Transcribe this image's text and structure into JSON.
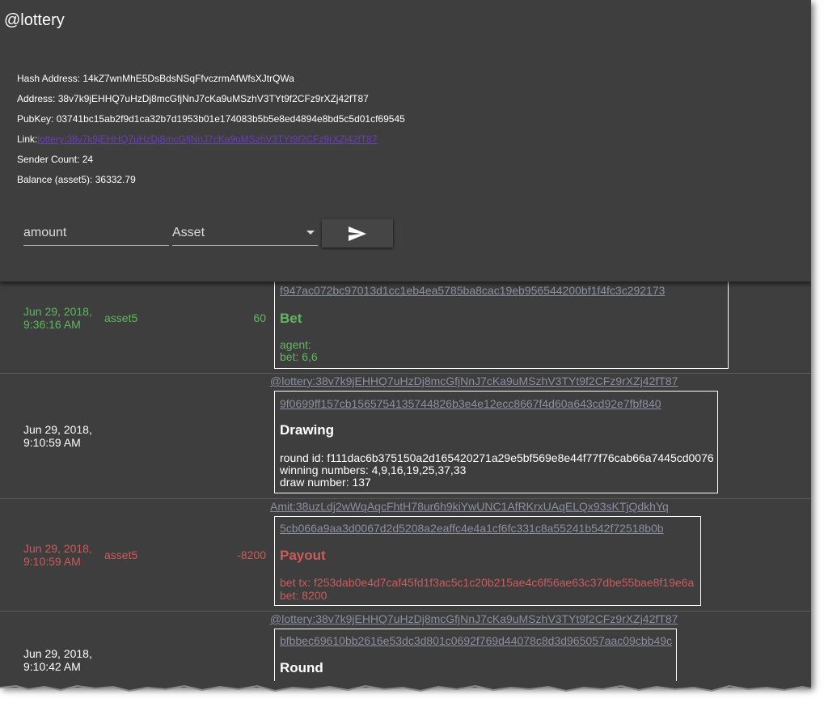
{
  "header": {
    "title": "@lottery",
    "hash_address": "Hash Address: 14kZ7wnMhE5DsBdsNSqFfvczrmAfWfsXJtrQWa",
    "address": "Address: 38v7k9jEHHQ7uHzDj8mcGfjNnJ7cKa9uMSzhV3TYt9f2CFz9rXZj42fT87",
    "pubkey": "PubKey: 03741bc15ab2f9d1ca32b7d1953b01e174083b5b5e8ed4894e8bd5c5d01cf69545",
    "link_label": "Link:",
    "link_text": "lottery:38v7k9jEHHQ7uHzDj8mcGfjNnJ7cKa9uMSzhV3TYt9f2CFz9rXZj42fT87",
    "sender_count": "Sender Count: 24",
    "balance": "Balance (asset5): 36332.79"
  },
  "form": {
    "amount_placeholder": "amount",
    "asset_placeholder": "Asset",
    "send_icon": "send-icon"
  },
  "colors": {
    "background": "#3e3e3e",
    "credit": "#5fb760",
    "debit": "#cc5b5b",
    "link": "#8a8fa0"
  },
  "transactions": [
    {
      "date_line1": "Jun 29, 2018,",
      "date_line2": "9:36:16 AM",
      "asset": "asset5",
      "amount": "60",
      "sender": "",
      "txid": "f947ac072bc97013d1cc1eb4ea5785ba8cac19eb956544200bf1f4fc3c292173",
      "type": "Bet",
      "details": [
        "agent:",
        "bet: 6,6"
      ]
    },
    {
      "date_line1": "Jun 29, 2018,",
      "date_line2": "9:10:59 AM",
      "asset": "",
      "amount": "",
      "sender": "@lottery:38v7k9jEHHQ7uHzDj8mcGfjNnJ7cKa9uMSzhV3TYt9f2CFz9rXZj42fT87",
      "txid": "9f0699ff157cb1565754135744826b3e4e12ecc8667f4d60a643cd92e7fbf840",
      "type": "Drawing",
      "details": [
        "round id: f111dac6b375150a2d165420271a29e5bf569e8e44f77f76cab66a7445cd0076",
        "winning numbers: 4,9,16,19,25,37,33",
        "draw number: 137"
      ]
    },
    {
      "date_line1": "Jun 29, 2018,",
      "date_line2": "9:10:59 AM",
      "asset": "asset5",
      "amount": "-8200",
      "sender": "Amit:38uzLdj2wWqAqcFhtH78ur6h9kiYwUNC1AfRKrxUAqELQx93sKTjQdkhYq",
      "txid": "5cb066a9aa3d0067d2d5208a2eaffc4e4a1cf6fc331c8a55241b542f72518b0b",
      "type": "Payout",
      "details": [
        "bet tx: f253dab0e4d7caf45fd1f3ac5c1c20b215ae4c6f56ae63c37dbe55bae8f19e6a",
        "bet: 8200"
      ]
    },
    {
      "date_line1": "Jun 29, 2018,",
      "date_line2": "9:10:42 AM",
      "asset": "",
      "amount": "",
      "sender": "@lottery:38v7k9jEHHQ7uHzDj8mcGfjNnJ7cKa9uMSzhV3TYt9f2CFz9rXZj42fT87",
      "txid": "bfbbec69610bb2616e53dc3d801c0692f769d44078c8d3d965057aac09cbb49c",
      "type": "Round",
      "details": []
    }
  ]
}
